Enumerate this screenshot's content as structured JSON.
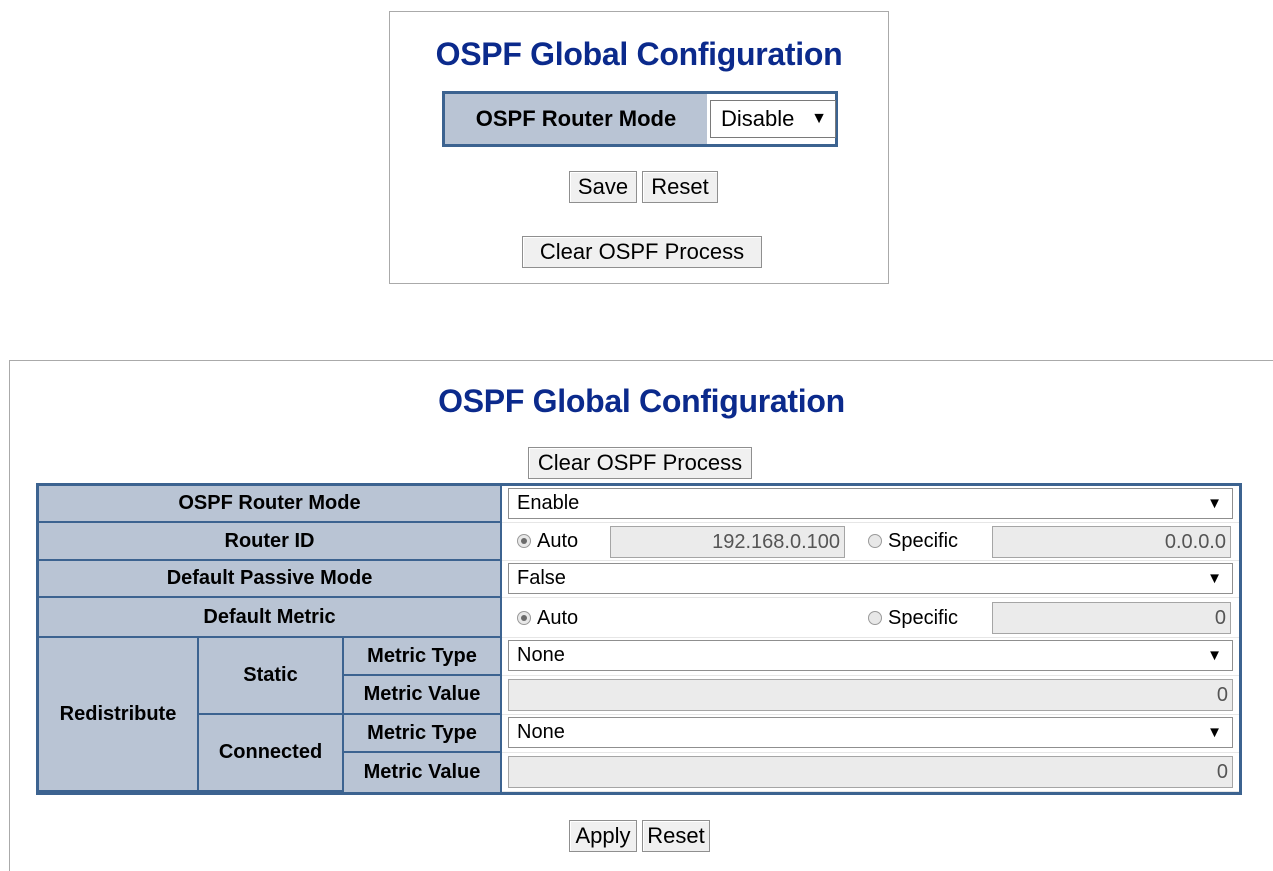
{
  "panel1": {
    "title": "OSPF Global Configuration",
    "router_mode_label": "OSPF Router Mode",
    "router_mode_value": "Disable",
    "save_label": "Save",
    "reset_label": "Reset",
    "clear_label": "Clear OSPF Process"
  },
  "panel2": {
    "title": "OSPF Global Configuration",
    "clear_label": "Clear OSPF Process",
    "router_mode": {
      "label": "OSPF Router Mode",
      "value": "Enable"
    },
    "router_id": {
      "label": "Router ID",
      "auto_label": "Auto",
      "auto_value": "192.168.0.100",
      "specific_label": "Specific",
      "specific_value": "0.0.0.0",
      "selected": "auto"
    },
    "passive_mode": {
      "label": "Default Passive Mode",
      "value": "False"
    },
    "default_metric": {
      "label": "Default Metric",
      "auto_label": "Auto",
      "specific_label": "Specific",
      "specific_value": "0",
      "selected": "auto"
    },
    "redistribute": {
      "label": "Redistribute",
      "static": {
        "label": "Static",
        "metric_type_label": "Metric Type",
        "metric_type_value": "None",
        "metric_value_label": "Metric Value",
        "metric_value": "0"
      },
      "connected": {
        "label": "Connected",
        "metric_type_label": "Metric Type",
        "metric_type_value": "None",
        "metric_value_label": "Metric Value",
        "metric_value": "0"
      }
    },
    "apply_label": "Apply",
    "reset_label": "Reset"
  },
  "icons": {
    "dropdown": "dropdown-arrow-icon",
    "radio": "radio-button-icon"
  },
  "colors": {
    "title": "#0b2a8c",
    "header_bg": "#b9c4d4",
    "border": "#3c6390"
  }
}
